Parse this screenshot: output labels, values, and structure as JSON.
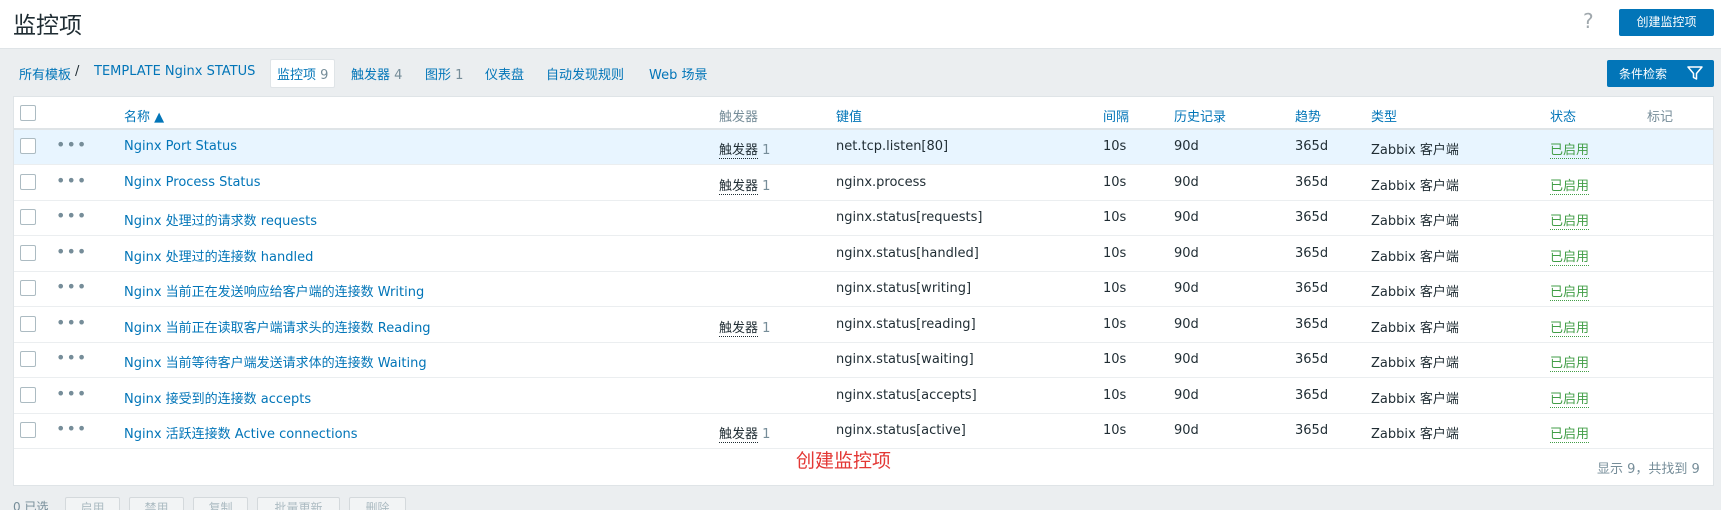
{
  "header": {
    "title": "监控项",
    "help": "?",
    "create_label": "创建监控项"
  },
  "breadcrumb": {
    "all_templates": "所有模板",
    "separator": "/",
    "template": "TEMPLATE Nginx STATUS",
    "items_label": "监控项",
    "items_count": "9",
    "triggers_label": "触发器",
    "triggers_count": "4",
    "graphs_label": "图形",
    "graphs_count": "1",
    "dashboards_label": "仪表盘",
    "discovery_label": "自动发现规则",
    "web_label": "Web 场景"
  },
  "filter": {
    "label": "条件检索",
    "icon": "filter-icon"
  },
  "columns": {
    "name": "名称 ▲",
    "triggers": "触发器",
    "key": "键值",
    "interval": "间隔",
    "history": "历史记录",
    "trends": "趋势",
    "type": "类型",
    "status": "状态",
    "tags": "标记"
  },
  "rows": [
    {
      "dots": "•••",
      "name": "Nginx Port Status",
      "trig": "触发器",
      "trig_count": "1",
      "key": "net.tcp.listen[80]",
      "interval": "10s",
      "history": "90d",
      "trends": "365d",
      "type": "Zabbix 客户端",
      "status": "已启用"
    },
    {
      "dots": "•••",
      "name": "Nginx Process Status",
      "trig": "触发器",
      "trig_count": "1",
      "key": "nginx.process",
      "interval": "10s",
      "history": "90d",
      "trends": "365d",
      "type": "Zabbix 客户端",
      "status": "已启用"
    },
    {
      "dots": "•••",
      "name": "Nginx 处理过的请求数 requests",
      "trig": "",
      "trig_count": "",
      "key": "nginx.status[requests]",
      "interval": "10s",
      "history": "90d",
      "trends": "365d",
      "type": "Zabbix 客户端",
      "status": "已启用"
    },
    {
      "dots": "•••",
      "name": "Nginx 处理过的连接数 handled",
      "trig": "",
      "trig_count": "",
      "key": "nginx.status[handled]",
      "interval": "10s",
      "history": "90d",
      "trends": "365d",
      "type": "Zabbix 客户端",
      "status": "已启用"
    },
    {
      "dots": "•••",
      "name": "Nginx 当前正在发送响应给客户端的连接数 Writing",
      "trig": "",
      "trig_count": "",
      "key": "nginx.status[writing]",
      "interval": "10s",
      "history": "90d",
      "trends": "365d",
      "type": "Zabbix 客户端",
      "status": "已启用"
    },
    {
      "dots": "•••",
      "name": "Nginx 当前正在读取客户端请求头的连接数 Reading",
      "trig": "触发器",
      "trig_count": "1",
      "key": "nginx.status[reading]",
      "interval": "10s",
      "history": "90d",
      "trends": "365d",
      "type": "Zabbix 客户端",
      "status": "已启用"
    },
    {
      "dots": "•••",
      "name": "Nginx 当前等待客户端发送请求体的连接数 Waiting",
      "trig": "",
      "trig_count": "",
      "key": "nginx.status[waiting]",
      "interval": "10s",
      "history": "90d",
      "trends": "365d",
      "type": "Zabbix 客户端",
      "status": "已启用"
    },
    {
      "dots": "•••",
      "name": "Nginx 接受到的连接数 accepts",
      "trig": "",
      "trig_count": "",
      "key": "nginx.status[accepts]",
      "interval": "10s",
      "history": "90d",
      "trends": "365d",
      "type": "Zabbix 客户端",
      "status": "已启用"
    },
    {
      "dots": "•••",
      "name": "Nginx 活跃连接数 Active connections",
      "trig": "触发器",
      "trig_count": "1",
      "key": "nginx.status[active]",
      "interval": "10s",
      "history": "90d",
      "trends": "365d",
      "type": "Zabbix 客户端",
      "status": "已启用"
    }
  ],
  "footer": {
    "create_link": "创建监控项",
    "count_text": "显示 9，共找到 9"
  },
  "actions": {
    "selected": "0 已选",
    "enable": "启用",
    "disable": "禁用",
    "copy": "复制",
    "mass_update": "批量更新",
    "delete": "删除"
  },
  "colors": {
    "accent": "#0275b8",
    "enabled": "#429e47",
    "annotation": "#e33734",
    "highlight_row": "#e8f5ff"
  }
}
